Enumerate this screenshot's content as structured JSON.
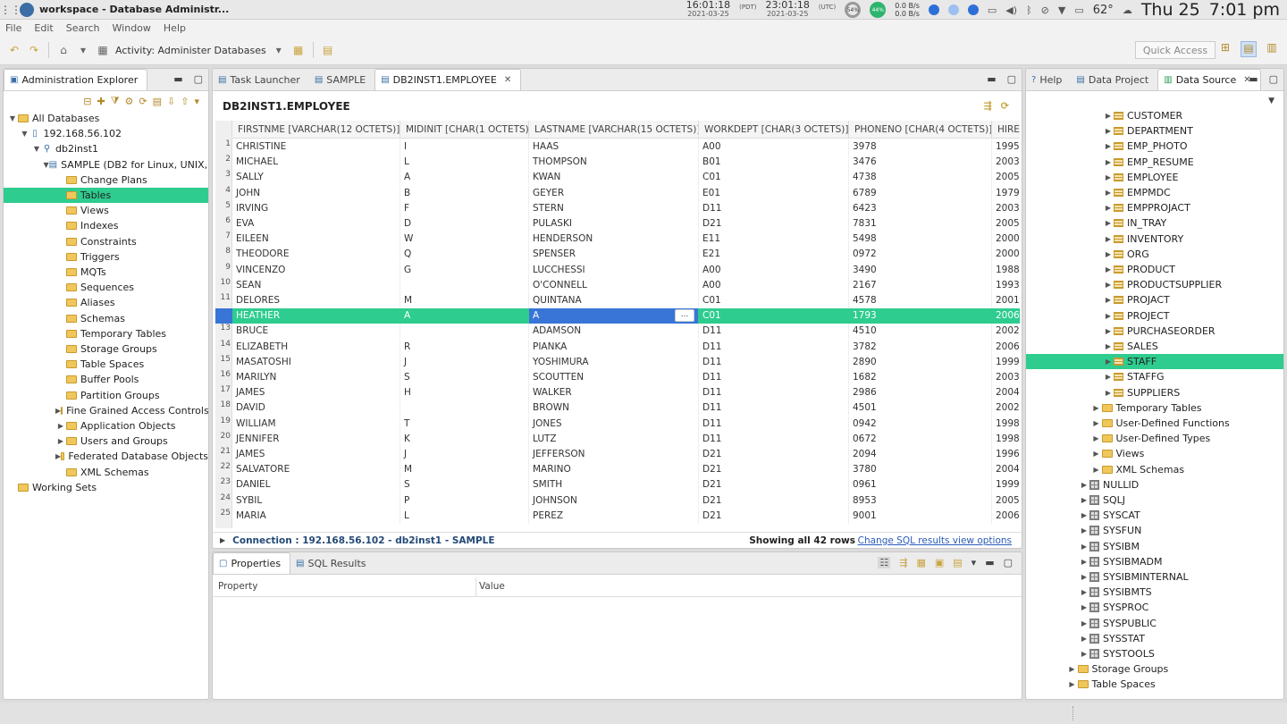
{
  "system": {
    "window_title": "workspace - Database Administr...",
    "clock1_time": "16:01:18",
    "clock1_tz": "(PDT)",
    "clock1_date": "2021-03-25",
    "clock2_time": "23:01:18",
    "clock2_tz": "(UTC)",
    "clock2_date": "2021-03-25",
    "gauge1": "54%",
    "gauge2": "44%",
    "net_up": "0.0 B/s",
    "net_down": "0.0 B/s",
    "temperature": "62°",
    "day": "Thu 25",
    "time": "7:01 pm"
  },
  "menu": [
    "File",
    "Edit",
    "Search",
    "Window",
    "Help"
  ],
  "toolbar": {
    "activity": "Activity: Administer Databases",
    "quick_access": "Quick Access"
  },
  "explorer": {
    "title": "Administration Explorer",
    "tree": [
      {
        "label": "All Databases",
        "level": 0,
        "tw": "▼",
        "icon": "folder"
      },
      {
        "label": "192.168.56.102",
        "level": 1,
        "tw": "▼",
        "icon": "host"
      },
      {
        "label": "db2inst1",
        "level": 2,
        "tw": "▼",
        "icon": "instance"
      },
      {
        "label": "SAMPLE (DB2 for Linux, UNIX, a",
        "level": 3,
        "tw": "▼",
        "icon": "database"
      },
      {
        "label": "Change Plans",
        "level": 4,
        "tw": "",
        "icon": "folder"
      },
      {
        "label": "Tables",
        "level": 4,
        "tw": "",
        "icon": "folder",
        "selected": true
      },
      {
        "label": "Views",
        "level": 4,
        "tw": "",
        "icon": "folder"
      },
      {
        "label": "Indexes",
        "level": 4,
        "tw": "",
        "icon": "folder"
      },
      {
        "label": "Constraints",
        "level": 4,
        "tw": "",
        "icon": "folder"
      },
      {
        "label": "Triggers",
        "level": 4,
        "tw": "",
        "icon": "folder"
      },
      {
        "label": "MQTs",
        "level": 4,
        "tw": "",
        "icon": "folder"
      },
      {
        "label": "Sequences",
        "level": 4,
        "tw": "",
        "icon": "folder"
      },
      {
        "label": "Aliases",
        "level": 4,
        "tw": "",
        "icon": "folder"
      },
      {
        "label": "Schemas",
        "level": 4,
        "tw": "",
        "icon": "folder"
      },
      {
        "label": "Temporary Tables",
        "level": 4,
        "tw": "",
        "icon": "folder"
      },
      {
        "label": "Storage Groups",
        "level": 4,
        "tw": "",
        "icon": "folder"
      },
      {
        "label": "Table Spaces",
        "level": 4,
        "tw": "",
        "icon": "folder"
      },
      {
        "label": "Buffer Pools",
        "level": 4,
        "tw": "",
        "icon": "folder"
      },
      {
        "label": "Partition Groups",
        "level": 4,
        "tw": "",
        "icon": "folder"
      },
      {
        "label": "Fine Grained Access Controls",
        "level": 4,
        "tw": "▶",
        "icon": "folder"
      },
      {
        "label": "Application Objects",
        "level": 4,
        "tw": "▶",
        "icon": "folder"
      },
      {
        "label": "Users and Groups",
        "level": 4,
        "tw": "▶",
        "icon": "folder"
      },
      {
        "label": "Federated Database Objects",
        "level": 4,
        "tw": "▶",
        "icon": "folder"
      },
      {
        "label": "XML Schemas",
        "level": 4,
        "tw": "",
        "icon": "folder"
      },
      {
        "label": "Working Sets",
        "level": 0,
        "tw": "",
        "icon": "folder"
      }
    ]
  },
  "editor": {
    "tabs": [
      {
        "label": "Task Launcher",
        "active": false
      },
      {
        "label": "SAMPLE",
        "active": false
      },
      {
        "label": "DB2INST1.EMPLOYEE",
        "active": true
      }
    ],
    "title": "DB2INST1.EMPLOYEE",
    "columns": [
      "FIRSTNME [VARCHAR(12 OCTETS)]",
      "MIDINIT [CHAR(1 OCTETS)]",
      "LASTNAME [VARCHAR(15 OCTETS)]",
      "WORKDEPT [CHAR(3 OCTETS)]",
      "PHONENO [CHAR(4 OCTETS)]",
      "HIRE"
    ],
    "rows": [
      [
        "CHRISTINE",
        "I",
        "HAAS",
        "A00",
        "3978",
        "1995-"
      ],
      [
        "MICHAEL",
        "L",
        "THOMPSON",
        "B01",
        "3476",
        "2003"
      ],
      [
        "SALLY",
        "A",
        "KWAN",
        "C01",
        "4738",
        "2005"
      ],
      [
        "JOHN",
        "B",
        "GEYER",
        "E01",
        "6789",
        "1979-"
      ],
      [
        "IRVING",
        "F",
        "STERN",
        "D11",
        "6423",
        "2003"
      ],
      [
        "EVA",
        "D",
        "PULASKI",
        "D21",
        "7831",
        "2005"
      ],
      [
        "EILEEN",
        "W",
        "HENDERSON",
        "E11",
        "5498",
        "2000"
      ],
      [
        "THEODORE",
        "Q",
        "SPENSER",
        "E21",
        "0972",
        "2000"
      ],
      [
        "VINCENZO",
        "G",
        "LUCCHESSI",
        "A00",
        "3490",
        "1988-"
      ],
      [
        "SEAN",
        "",
        "O'CONNELL",
        "A00",
        "2167",
        "1993-"
      ],
      [
        "DELORES",
        "M",
        "QUINTANA",
        "C01",
        "4578",
        "2001-"
      ],
      [
        "HEATHER",
        "A",
        "A",
        "C01",
        "1793",
        "2006"
      ],
      [
        "BRUCE",
        "",
        "ADAMSON",
        "D11",
        "4510",
        "2002"
      ],
      [
        "ELIZABETH",
        "R",
        "PIANKA",
        "D11",
        "3782",
        "2006"
      ],
      [
        "MASATOSHI",
        "J",
        "YOSHIMURA",
        "D11",
        "2890",
        "1999-"
      ],
      [
        "MARILYN",
        "S",
        "SCOUTTEN",
        "D11",
        "1682",
        "2003"
      ],
      [
        "JAMES",
        "H",
        "WALKER",
        "D11",
        "2986",
        "2004"
      ],
      [
        "DAVID",
        "",
        "BROWN",
        "D11",
        "4501",
        "2002"
      ],
      [
        "WILLIAM",
        "T",
        "JONES",
        "D11",
        "0942",
        "1998-"
      ],
      [
        "JENNIFER",
        "K",
        "LUTZ",
        "D11",
        "0672",
        "1998-"
      ],
      [
        "JAMES",
        "J",
        "JEFFERSON",
        "D21",
        "2094",
        "1996-"
      ],
      [
        "SALVATORE",
        "M",
        "MARINO",
        "D21",
        "3780",
        "2004"
      ],
      [
        "DANIEL",
        "S",
        "SMITH",
        "D21",
        "0961",
        "1999-"
      ],
      [
        "SYBIL",
        "P",
        "JOHNSON",
        "D21",
        "8953",
        "2005"
      ],
      [
        "MARIA",
        "L",
        "PEREZ",
        "D21",
        "9001",
        "2006"
      ]
    ],
    "selected_row": 12,
    "editing_cell_ellipsis": "...",
    "connection": "Connection : 192.168.56.102 - db2inst1 - SAMPLE",
    "row_count": "Showing all 42 rows",
    "options_link": "Change SQL results view options"
  },
  "properties": {
    "tabs": [
      {
        "label": "Properties",
        "active": true
      },
      {
        "label": "SQL Results",
        "active": false
      }
    ],
    "col_property": "Property",
    "col_value": "Value"
  },
  "datasource": {
    "tabs": [
      {
        "label": "Help",
        "active": false
      },
      {
        "label": "Data Project",
        "active": false
      },
      {
        "label": "Data Source",
        "active": true
      }
    ],
    "tree": [
      {
        "label": "CUSTOMER",
        "level": 6,
        "icon": "table",
        "tw": "▶"
      },
      {
        "label": "DEPARTMENT",
        "level": 6,
        "icon": "table",
        "tw": "▶"
      },
      {
        "label": "EMP_PHOTO",
        "level": 6,
        "icon": "table",
        "tw": "▶"
      },
      {
        "label": "EMP_RESUME",
        "level": 6,
        "icon": "table",
        "tw": "▶"
      },
      {
        "label": "EMPLOYEE",
        "level": 6,
        "icon": "table",
        "tw": "▶"
      },
      {
        "label": "EMPMDC",
        "level": 6,
        "icon": "table",
        "tw": "▶"
      },
      {
        "label": "EMPPROJACT",
        "level": 6,
        "icon": "table",
        "tw": "▶"
      },
      {
        "label": "IN_TRAY",
        "level": 6,
        "icon": "table",
        "tw": "▶"
      },
      {
        "label": "INVENTORY",
        "level": 6,
        "icon": "table",
        "tw": "▶"
      },
      {
        "label": "ORG",
        "level": 6,
        "icon": "table",
        "tw": "▶"
      },
      {
        "label": "PRODUCT",
        "level": 6,
        "icon": "table",
        "tw": "▶"
      },
      {
        "label": "PRODUCTSUPPLIER",
        "level": 6,
        "icon": "table",
        "tw": "▶"
      },
      {
        "label": "PROJACT",
        "level": 6,
        "icon": "table",
        "tw": "▶"
      },
      {
        "label": "PROJECT",
        "level": 6,
        "icon": "table",
        "tw": "▶"
      },
      {
        "label": "PURCHASEORDER",
        "level": 6,
        "icon": "table",
        "tw": "▶"
      },
      {
        "label": "SALES",
        "level": 6,
        "icon": "table",
        "tw": "▶"
      },
      {
        "label": "STAFF",
        "level": 6,
        "icon": "table",
        "tw": "▶",
        "selected": true
      },
      {
        "label": "STAFFG",
        "level": 6,
        "icon": "table",
        "tw": "▶"
      },
      {
        "label": "SUPPLIERS",
        "level": 6,
        "icon": "table",
        "tw": "▶"
      },
      {
        "label": "Temporary Tables",
        "level": 5,
        "icon": "folder",
        "tw": "▶"
      },
      {
        "label": "User-Defined Functions",
        "level": 5,
        "icon": "folder",
        "tw": "▶"
      },
      {
        "label": "User-Defined Types",
        "level": 5,
        "icon": "folder",
        "tw": "▶"
      },
      {
        "label": "Views",
        "level": 5,
        "icon": "folder",
        "tw": "▶"
      },
      {
        "label": "XML Schemas",
        "level": 5,
        "icon": "folder",
        "tw": "▶"
      },
      {
        "label": "NULLID",
        "level": 4,
        "icon": "schema",
        "tw": "▶"
      },
      {
        "label": "SQLJ",
        "level": 4,
        "icon": "schema",
        "tw": "▶"
      },
      {
        "label": "SYSCAT",
        "level": 4,
        "icon": "schema",
        "tw": "▶"
      },
      {
        "label": "SYSFUN",
        "level": 4,
        "icon": "schema",
        "tw": "▶"
      },
      {
        "label": "SYSIBM",
        "level": 4,
        "icon": "schema",
        "tw": "▶"
      },
      {
        "label": "SYSIBMADM",
        "level": 4,
        "icon": "schema",
        "tw": "▶"
      },
      {
        "label": "SYSIBMINTERNAL",
        "level": 4,
        "icon": "schema",
        "tw": "▶"
      },
      {
        "label": "SYSIBMTS",
        "level": 4,
        "icon": "schema",
        "tw": "▶"
      },
      {
        "label": "SYSPROC",
        "level": 4,
        "icon": "schema",
        "tw": "▶"
      },
      {
        "label": "SYSPUBLIC",
        "level": 4,
        "icon": "schema",
        "tw": "▶"
      },
      {
        "label": "SYSSTAT",
        "level": 4,
        "icon": "schema",
        "tw": "▶"
      },
      {
        "label": "SYSTOOLS",
        "level": 4,
        "icon": "schema",
        "tw": "▶"
      },
      {
        "label": "Storage Groups",
        "level": 3,
        "icon": "folder",
        "tw": "▶"
      },
      {
        "label": "Table Spaces",
        "level": 3,
        "icon": "folder",
        "tw": "▶"
      }
    ]
  },
  "colors": {
    "selection": "#2ecc8f",
    "edit_cell": "#3875d7",
    "link": "#2a5bb8"
  }
}
